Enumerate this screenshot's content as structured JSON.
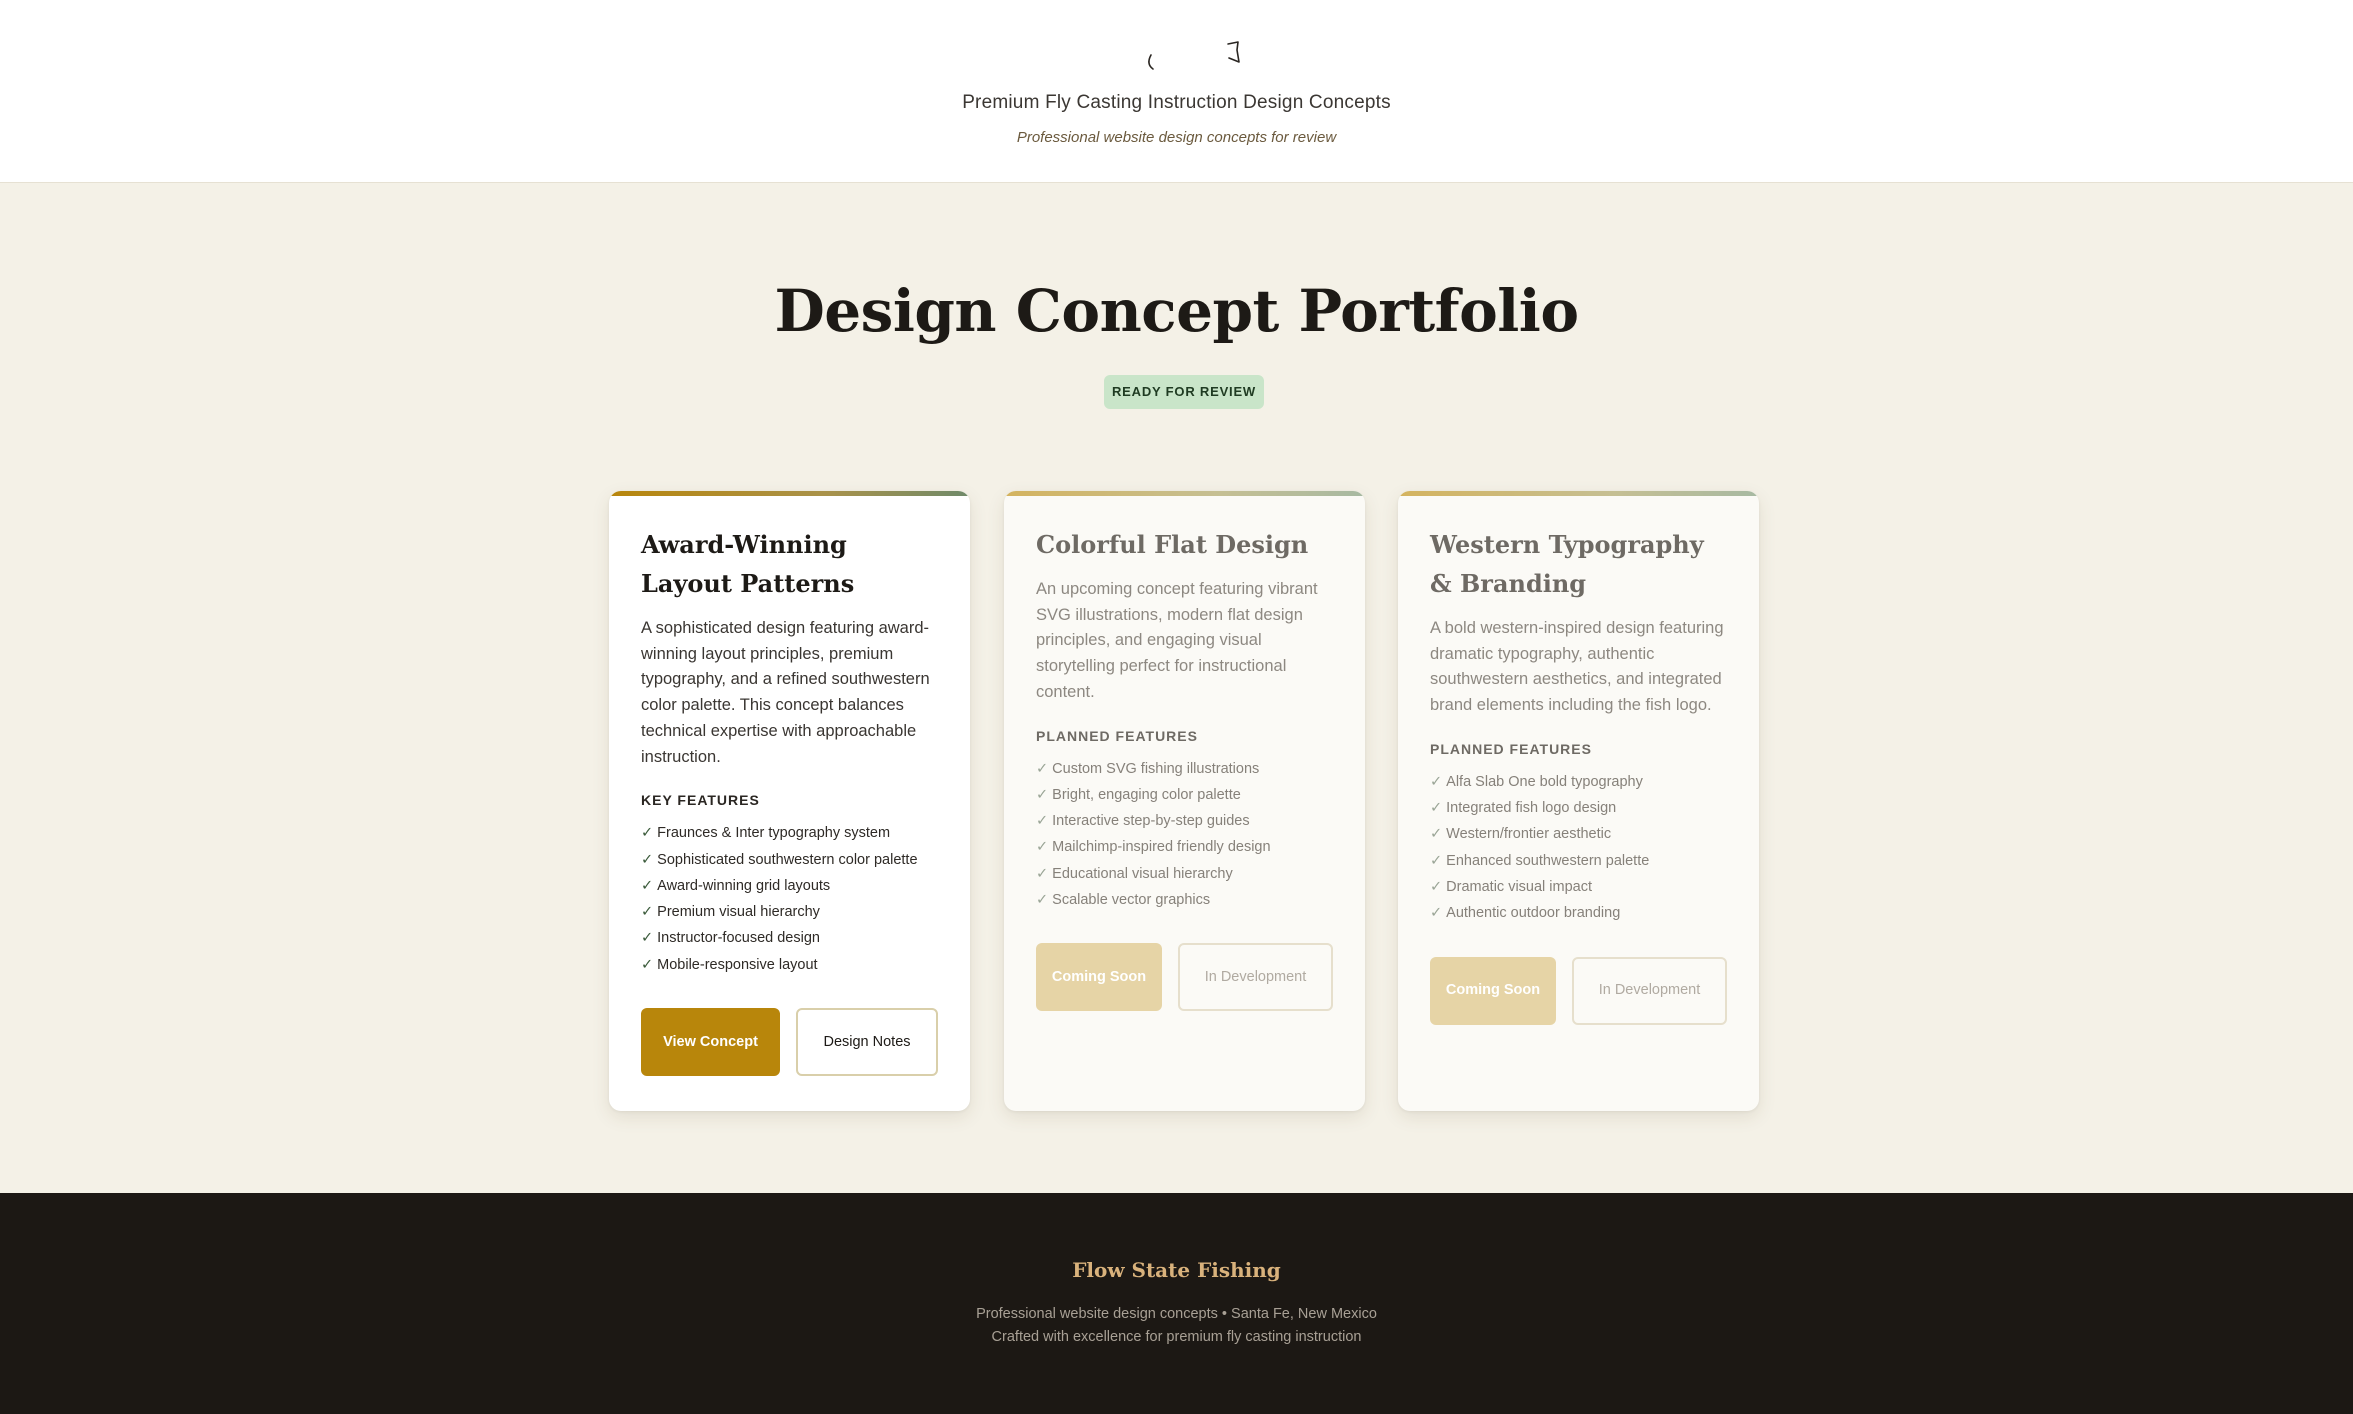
{
  "header": {
    "title": "Premium Fly Casting Instruction Design Concepts",
    "subtitle": "Professional website design concepts for review",
    "logo_icon": "fish-logo-icon"
  },
  "main": {
    "title": "Design Concept Portfolio",
    "badge": "READY FOR REVIEW"
  },
  "cards": [
    {
      "title": "Award-Winning Layout Patterns",
      "description": "A sophisticated design featuring award-winning layout principles, premium typography, and a refined southwestern color palette. This concept balances technical expertise with approachable instruction.",
      "features_heading": "KEY FEATURES",
      "features": [
        "Fraunces & Inter typography system",
        "Sophisticated southwestern color palette",
        "Award-winning grid layouts",
        "Premium visual hierarchy",
        "Instructor-focused design",
        "Mobile-responsive layout"
      ],
      "primary_button": "View Concept",
      "secondary_button": "Design Notes"
    },
    {
      "title": "Colorful Flat Design",
      "description": "An upcoming concept featuring vibrant SVG illustrations, modern flat design principles, and engaging visual storytelling perfect for instructional content.",
      "features_heading": "PLANNED FEATURES",
      "features": [
        "Custom SVG fishing illustrations",
        "Bright, engaging color palette",
        "Interactive step-by-step guides",
        "Mailchimp-inspired friendly design",
        "Educational visual hierarchy",
        "Scalable vector graphics"
      ],
      "primary_button": "Coming Soon",
      "secondary_button": "In Development"
    },
    {
      "title": "Western Typography & Branding",
      "description": "A bold western-inspired design featuring dramatic typography, authentic southwestern aesthetics, and integrated brand elements including the fish logo.",
      "features_heading": "PLANNED FEATURES",
      "features": [
        "Alfa Slab One bold typography",
        "Integrated fish logo design",
        "Western/frontier aesthetic",
        "Enhanced southwestern palette",
        "Dramatic visual impact",
        "Authentic outdoor branding"
      ],
      "primary_button": "Coming Soon",
      "secondary_button": "In Development"
    }
  ],
  "check_glyph": "✓",
  "footer": {
    "brand": "Flow State Fishing",
    "line1": "Professional website design concepts • Santa Fe, New Mexico",
    "line2": "Crafted with excellence for premium fly casting instruction"
  },
  "colors": {
    "accent": "#b8860b",
    "background": "#f4f1e7",
    "badge": "#c9e5c9",
    "footer": "#1c1814"
  }
}
